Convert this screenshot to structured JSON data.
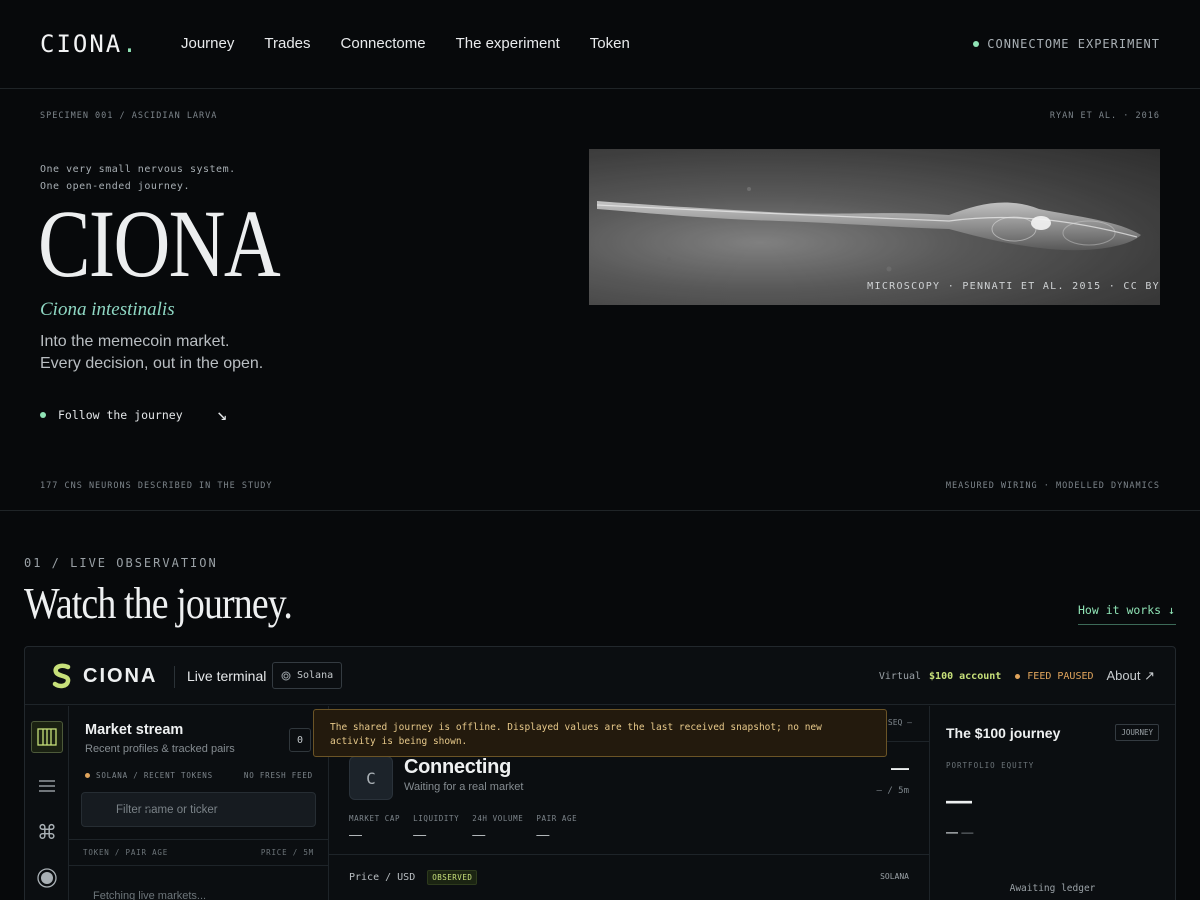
{
  "nav": {
    "logo": "CIONA",
    "logo_dot": ".",
    "links": [
      "Journey",
      "Trades",
      "Connectome",
      "The experiment",
      "Token"
    ],
    "status": "CONNECTOME EXPERIMENT"
  },
  "hero": {
    "specimen_label": "SPECIMEN 001 / ASCIDIAN LARVA",
    "citation": "RYAN ET AL. · 2016",
    "tagline_1": "One very small nervous system.",
    "tagline_2": "One open-ended journey.",
    "title": "CIONA",
    "species": "Ciona intestinalis",
    "lede_1": "Into the memecoin market.",
    "lede_2": "Every decision, out in the open.",
    "cta": "Follow the journey",
    "cta_arrow": "↘",
    "image_caption": "MICROSCOPY · PENNATI ET AL. 2015 · CC BY",
    "footnote_left": "177 CNS NEURONS DESCRIBED IN THE STUDY",
    "footnote_right": "MEASURED WIRING · MODELLED DYNAMICS"
  },
  "section": {
    "label": "01 / LIVE OBSERVATION",
    "title": "Watch the journey.",
    "how_it_works": "How it works ↓"
  },
  "terminal": {
    "brand": "CIONA",
    "mode": "Live terminal",
    "chain": "Solana",
    "virtual_label": "Virtual",
    "account": "$100 account",
    "feed_status": "FEED PAUSED",
    "about": "About ↗",
    "market": {
      "title": "Market stream",
      "subtitle": "Recent profiles & tracked pairs",
      "count": "0",
      "source": "SOLANA / RECENT TOKENS",
      "feed": "NO FRESH FEED",
      "filter_placeholder": "Filter name or ticker",
      "col_left": "TOKEN / PAIR AGE",
      "col_right": "PRICE / 5M",
      "loading": "Fetching live markets..."
    },
    "center": {
      "seq": "SEQ —",
      "badge": "C",
      "name": "Connecting",
      "waiting": "Waiting for a real market",
      "price_dash": "—",
      "change": "— / 5m",
      "stats": [
        {
          "k": "MARKET CAP",
          "v": "—"
        },
        {
          "k": "LIQUIDITY",
          "v": "—"
        },
        {
          "k": "24H VOLUME",
          "v": "—"
        },
        {
          "k": "PAIR AGE",
          "v": "—"
        }
      ],
      "price_label": "Price / USD",
      "observed": "OBSERVED",
      "chain": "SOLANA"
    },
    "journey": {
      "title": "The $100 journey",
      "tag": "JOURNEY",
      "equity_label": "PORTFOLIO EQUITY",
      "equity": "—",
      "delta_a": "—",
      "delta_b": "—",
      "awaiting": "Awaiting ledger"
    },
    "warning": "The shared journey is offline. Displayed values are the last received snapshot; no new activity is being shown."
  },
  "colors": {
    "accent_green": "#8fe3b5",
    "accent_lime": "#c7e07a",
    "warning_amber": "#e0a45c",
    "background": "#07090b"
  }
}
